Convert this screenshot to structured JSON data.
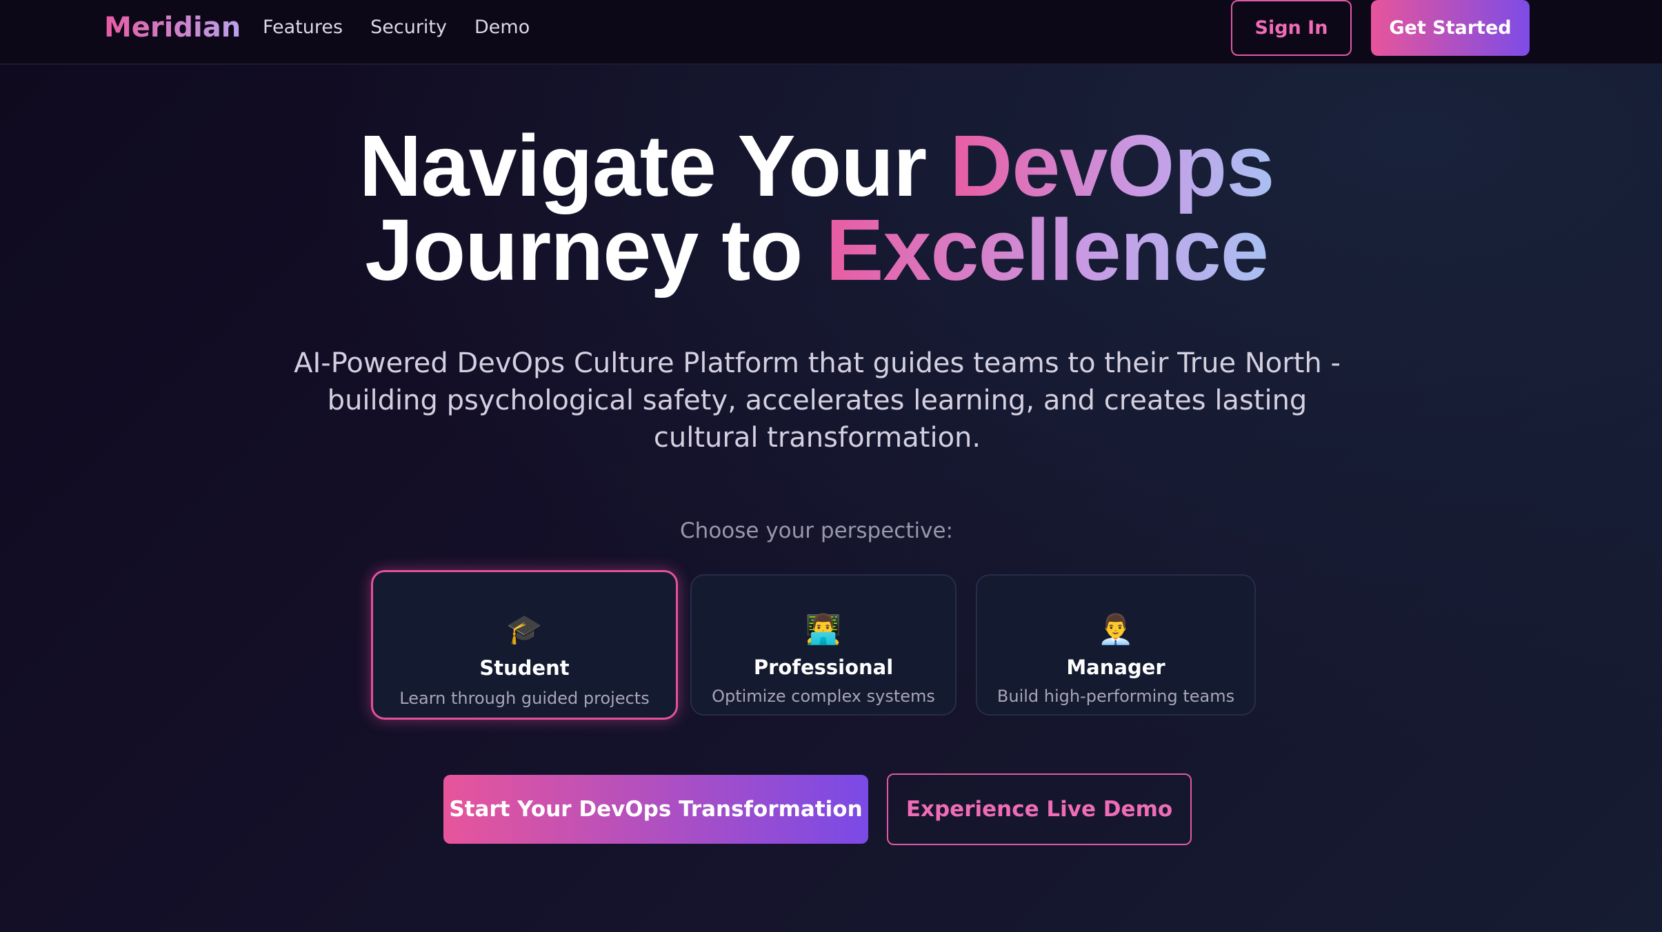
{
  "nav": {
    "brand": "Meridian",
    "links": [
      {
        "label": "Features"
      },
      {
        "label": "Security"
      },
      {
        "label": "Demo"
      }
    ],
    "sign_in_label": "Sign In",
    "get_started_label": "Get Started"
  },
  "hero": {
    "title_line1_plain": "Navigate Your",
    "title_line1_accent": "DevOps",
    "title_line2_plain": "Journey to",
    "title_line2_accent": "Excellence",
    "subtitle": "AI-Powered DevOps Culture Platform that guides teams to their True North - building psychological safety, accelerates learning, and creates lasting cultural transformation."
  },
  "perspective": {
    "prompt": "Choose your perspective:",
    "selected": "Student",
    "cards": [
      {
        "icon": "🎓",
        "icon_name": "graduation-cap-icon",
        "title": "Student",
        "description": "Learn through guided projects"
      },
      {
        "icon": "👨‍💻",
        "icon_name": "technologist-icon",
        "title": "Professional",
        "description": "Optimize complex systems"
      },
      {
        "icon": "👨‍💼",
        "icon_name": "office-worker-icon",
        "title": "Manager",
        "description": "Build high-performing teams"
      }
    ]
  },
  "cta": {
    "primary_label": "Start Your DevOps Transformation",
    "secondary_label": "Experience Live Demo"
  },
  "colors": {
    "accent_pink": "#e7559b",
    "accent_purple": "#7d4ce6",
    "background": "#0f0a1e",
    "card_background": "#141a30"
  }
}
